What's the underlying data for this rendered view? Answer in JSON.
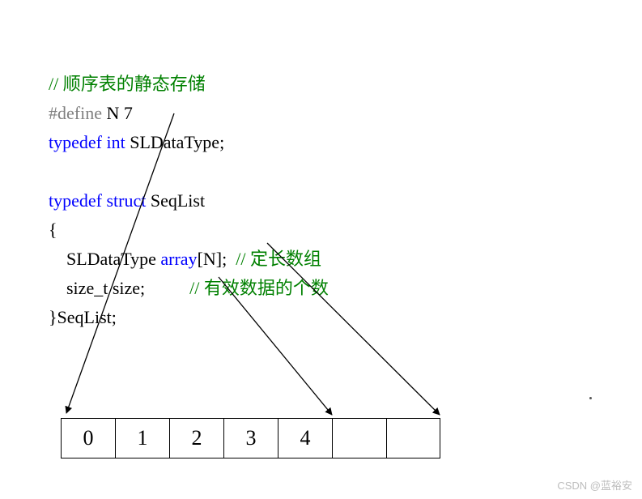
{
  "code": {
    "line1_comment": "// 顺序表的静态存储",
    "line2_define": "#define",
    "line2_rest": " N 7",
    "line3_typedef": "typedef",
    "line3_int": "int",
    "line3_rest": " SLDataType;",
    "line5_typedef": "typedef",
    "line5_struct": "struct",
    "line5_rest": " SeqList",
    "line6_brace": "{",
    "line7_indent": "    SLDataType ",
    "line7_array": "array",
    "line7_rest1": "[N];",
    "line7_comment": "  // 定长数组",
    "line8_indent": "    size_t size;",
    "line8_spacer": "          ",
    "line8_comment": "// 有效数据的个数",
    "line9_close": "}SeqList;"
  },
  "array_cells": [
    "0",
    "1",
    "2",
    "3",
    "4",
    "",
    ""
  ],
  "watermark": "CSDN @蓝裕安",
  "chart_data": {
    "type": "table",
    "title": "顺序表的静态存储 — 数组示意",
    "capacity_N": 7,
    "cells": [
      {
        "index": 0,
        "value": 0
      },
      {
        "index": 1,
        "value": 1
      },
      {
        "index": 2,
        "value": 2
      },
      {
        "index": 3,
        "value": 3
      },
      {
        "index": 4,
        "value": 4
      },
      {
        "index": 5,
        "value": null
      },
      {
        "index": 6,
        "value": null
      }
    ],
    "valid_size": 5,
    "arrows": [
      {
        "from": "SLDataType (typedef int)",
        "to": "array start (cell 0)"
      },
      {
        "from": "size_t size",
        "to": "valid data boundary (after cell 4)"
      },
      {
        "from": "array[N]",
        "to": "array end (cell 6 right edge)"
      }
    ]
  }
}
